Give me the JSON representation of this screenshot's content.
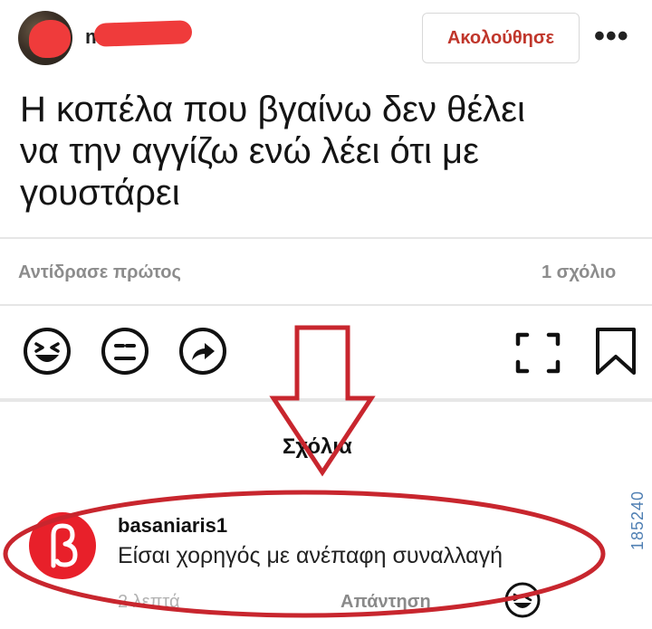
{
  "header": {
    "username": "markos15",
    "follow_label": "Ακολούθησε",
    "more_label": "•••"
  },
  "post": {
    "line1": "Η κοπέλα που βγαίνω δεν θέλει",
    "line2": "να την αγγίζω ενώ λέει ότι με",
    "line3": "γουστάρει"
  },
  "stats": {
    "react_first": "Αντίδρασε πρώτος",
    "comments_count": "1 σχόλιο"
  },
  "actions": {
    "icons": [
      "laugh-icon",
      "neutral-face-icon",
      "share-icon",
      "fullscreen-icon",
      "bookmark-icon"
    ]
  },
  "comments": {
    "title": "Σχόλια",
    "items": [
      {
        "user": "basaniaris1",
        "text": "Είσαι χορηγός με ανέπαφη συναλλαγή",
        "time": "2 λεπτά",
        "reply_label": "Απάντηση"
      }
    ]
  },
  "watermark": "185240",
  "colors": {
    "accent_red": "#c0362b",
    "annotation_red": "#c8262e",
    "muted_gray": "#8c8c8c",
    "divider": "#e6e6e6"
  }
}
